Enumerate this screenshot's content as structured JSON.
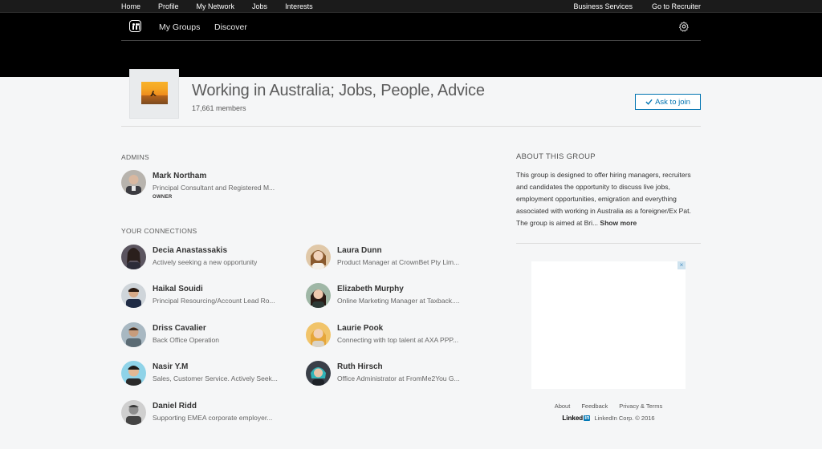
{
  "topnav": {
    "left": [
      "Home",
      "Profile",
      "My Network",
      "Jobs",
      "Interests"
    ],
    "right": [
      "Business Services",
      "Go to Recruiter"
    ]
  },
  "subnav": {
    "my_groups": "My Groups",
    "discover": "Discover"
  },
  "group": {
    "title": "Working in Australia; Jobs, People, Advice",
    "members": "17,661 members",
    "join_label": "Ask to join"
  },
  "admins": {
    "label": "ADMINS",
    "people": [
      {
        "name": "Mark Northam",
        "headline": "Principal Consultant and Registered M...",
        "badge": "OWNER"
      }
    ]
  },
  "connections": {
    "label": "YOUR CONNECTIONS",
    "people": [
      {
        "name": "Decia Anastassakis",
        "headline": "Actively seeking a new opportunity"
      },
      {
        "name": "Laura Dunn",
        "headline": "Product Manager at CrownBet Pty Lim..."
      },
      {
        "name": "Haikal Souidi",
        "headline": "Principal Resourcing/Account Lead Ro..."
      },
      {
        "name": "Elizabeth Murphy",
        "headline": "Online Marketing Manager at Taxback...."
      },
      {
        "name": "Driss Cavalier",
        "headline": "Back Office Operation"
      },
      {
        "name": "Laurie Pook",
        "headline": "Connecting with top talent at AXA PPP..."
      },
      {
        "name": "Nasir Y.M",
        "headline": "Sales, Customer Service. Actively Seek..."
      },
      {
        "name": "Ruth Hirsch",
        "headline": "Office Administrator at FromMe2You G..."
      },
      {
        "name": "Daniel Ridd",
        "headline": "Supporting EMEA corporate employer..."
      }
    ]
  },
  "about": {
    "title": "ABOUT THIS GROUP",
    "text": "This group is designed to offer hiring managers, recruiters and candidates the opportunity to discuss live jobs, employment opportunities, emigration and everything associated with working in Australia as a foreigner/Ex Pat. The group is aimed at Bri...",
    "show_more": "Show more"
  },
  "ad": {
    "close": "×"
  },
  "footer": {
    "links": [
      "About",
      "Feedback",
      "Privacy & Terms"
    ],
    "logo_text": "Linked",
    "logo_in": "in",
    "copyright": "LinkedIn Corp. © 2016"
  },
  "colors": {
    "accent": "#0073b1",
    "band": "#000000",
    "page": "#f5f6f7"
  },
  "icons": {
    "groups": "groups-icon",
    "settings": "gear-icon",
    "check": "check-icon"
  }
}
